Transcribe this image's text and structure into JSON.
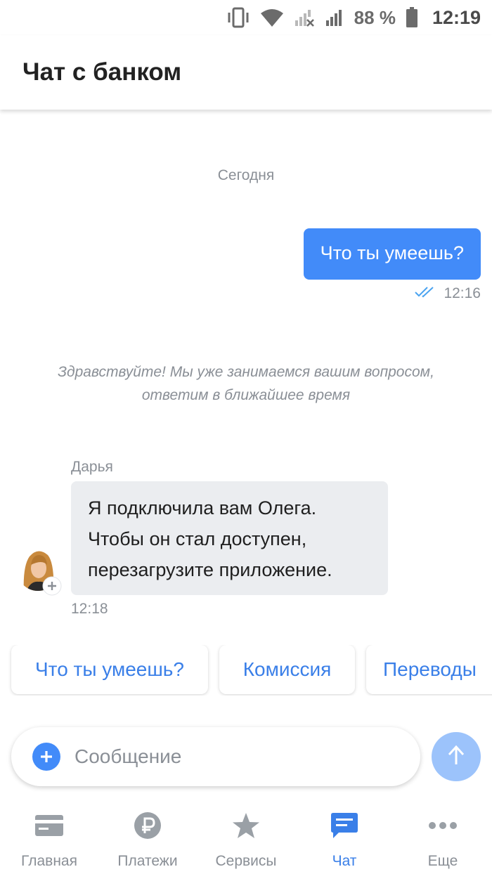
{
  "status_bar": {
    "battery": "88 %",
    "time": "12:19"
  },
  "header": {
    "title": "Чат с банком"
  },
  "chat": {
    "date_separator": "Сегодня",
    "outgoing": {
      "text": "Что ты умеешь?",
      "time": "12:16"
    },
    "system_message": {
      "line1": "Здравствуйте! Мы уже занимаемся вашим вопросом,",
      "line2": "ответим в ближайшее время"
    },
    "incoming": {
      "sender": "Дарья",
      "lines": [
        "Я подключила вам Олега.",
        "Чтобы он стал доступен,",
        "перезагрузите приложение."
      ],
      "time": "12:18"
    }
  },
  "quick_replies": [
    "Что ты умеешь?",
    "Комиссия",
    "Переводы"
  ],
  "composer": {
    "placeholder": "Сообщение"
  },
  "bottom_nav": [
    {
      "label": "Главная",
      "icon": "card-icon",
      "active": false
    },
    {
      "label": "Платежи",
      "icon": "ruble-icon",
      "active": false
    },
    {
      "label": "Сервисы",
      "icon": "star-icon",
      "active": false
    },
    {
      "label": "Чат",
      "icon": "chat-icon",
      "active": true
    },
    {
      "label": "Еще",
      "icon": "more-dots-icon",
      "active": false
    }
  ],
  "colors": {
    "accent": "#428bf9",
    "link": "#3a7fe8",
    "muted": "#8a8f96",
    "incoming_bubble": "#ebedf0",
    "send_disabled": "#9cc3fb"
  }
}
